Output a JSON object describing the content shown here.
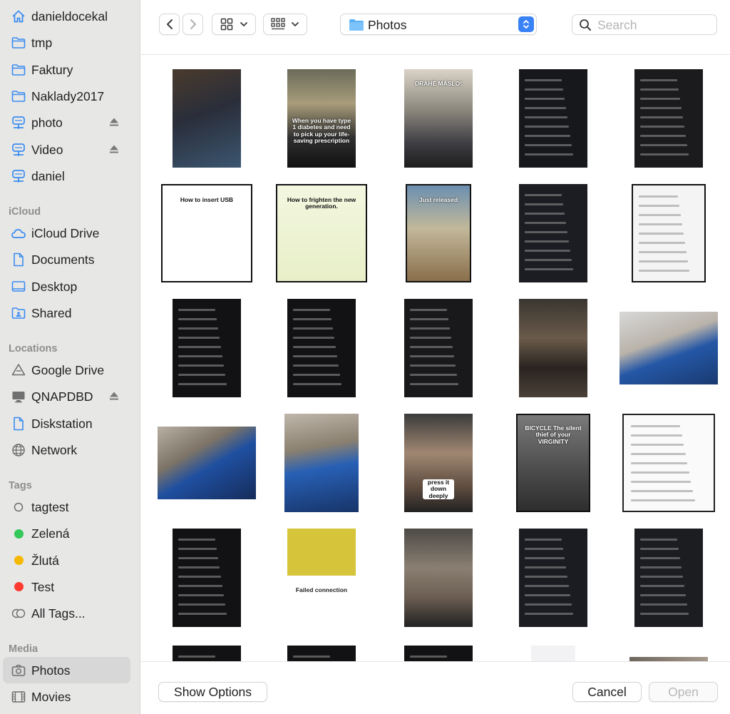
{
  "sidebar": {
    "favorites": [
      {
        "label": "danieldocekal",
        "icon": "home-icon"
      },
      {
        "label": "tmp",
        "icon": "folder-icon"
      },
      {
        "label": "Faktury",
        "icon": "folder-icon"
      },
      {
        "label": "Naklady2017",
        "icon": "folder-icon"
      },
      {
        "label": "photo",
        "icon": "network-volume-icon",
        "ejectable": true
      },
      {
        "label": "Video",
        "icon": "network-volume-icon",
        "ejectable": true
      },
      {
        "label": "daniel",
        "icon": "network-volume-icon"
      }
    ],
    "icloud_header": "iCloud",
    "icloud": [
      {
        "label": "iCloud Drive",
        "icon": "cloud-icon"
      },
      {
        "label": "Documents",
        "icon": "document-icon"
      },
      {
        "label": "Desktop",
        "icon": "desktop-icon"
      },
      {
        "label": "Shared",
        "icon": "shared-folder-icon"
      }
    ],
    "locations_header": "Locations",
    "locations": [
      {
        "label": "Google Drive",
        "icon": "drive-icon"
      },
      {
        "label": "QNAPDBD",
        "icon": "display-icon",
        "ejectable": true
      },
      {
        "label": "Diskstation",
        "icon": "document-icon"
      },
      {
        "label": "Network",
        "icon": "globe-icon"
      }
    ],
    "tags_header": "Tags",
    "tags": [
      {
        "label": "tagtest",
        "color": "none"
      },
      {
        "label": "Zelená",
        "color": "#34c759"
      },
      {
        "label": "Žlutá",
        "color": "#f5b800"
      },
      {
        "label": "Test",
        "color": "#ff3b30"
      },
      {
        "label": "All Tags...",
        "color": "all"
      }
    ],
    "media_header": "Media",
    "media": [
      {
        "label": "Photos",
        "icon": "camera-icon",
        "selected": true
      },
      {
        "label": "Movies",
        "icon": "film-icon"
      }
    ]
  },
  "toolbar": {
    "location": "Photos",
    "search_placeholder": "Search"
  },
  "grid": {
    "photos": [
      {
        "theme": "photo-woman",
        "caption": ""
      },
      {
        "theme": "phone-video",
        "caption": "When you have type 1 diabetes and need to pick up your life-saving prescription"
      },
      {
        "theme": "phone-video-light",
        "caption": "DRAHÉ MÁSLO!"
      },
      {
        "theme": "dark-menu",
        "caption": ""
      },
      {
        "theme": "dark-text",
        "caption": ""
      },
      {
        "theme": "meme-usb",
        "caption": "How to insert USB"
      },
      {
        "theme": "meme-cow",
        "caption": "How to frighten the new generation."
      },
      {
        "theme": "meme-books",
        "caption": "Just released"
      },
      {
        "theme": "dark-app",
        "caption": ""
      },
      {
        "theme": "light-text",
        "caption": ""
      },
      {
        "theme": "dark-thread",
        "caption": ""
      },
      {
        "theme": "dark-thread",
        "caption": ""
      },
      {
        "theme": "dark-red",
        "caption": ""
      },
      {
        "theme": "photo-cola",
        "caption": ""
      },
      {
        "theme": "photo-blue-box",
        "caption": ""
      },
      {
        "theme": "photo-blue-box-2",
        "caption": ""
      },
      {
        "theme": "photo-blue-box-3",
        "caption": ""
      },
      {
        "theme": "phone-video-woman",
        "caption": "press it down deeply"
      },
      {
        "theme": "meme-grey",
        "caption": "BICYCLE The silent thief of your VIRGINITY"
      },
      {
        "theme": "light-post",
        "caption": ""
      },
      {
        "theme": "dark-thread",
        "caption": ""
      },
      {
        "theme": "light-yellow",
        "caption": "Failed connection"
      },
      {
        "theme": "photo-event",
        "caption": ""
      },
      {
        "theme": "dark-video",
        "caption": ""
      },
      {
        "theme": "dark-list",
        "caption": ""
      },
      {
        "theme": "dark-thread",
        "caption": ""
      },
      {
        "theme": "dark-thread",
        "caption": ""
      },
      {
        "theme": "dark-thread",
        "caption": ""
      },
      {
        "theme": "light-settings",
        "caption": ""
      },
      {
        "theme": "photo-partial",
        "caption": ""
      }
    ]
  },
  "footer": {
    "show_options": "Show Options",
    "cancel": "Cancel",
    "open": "Open"
  }
}
